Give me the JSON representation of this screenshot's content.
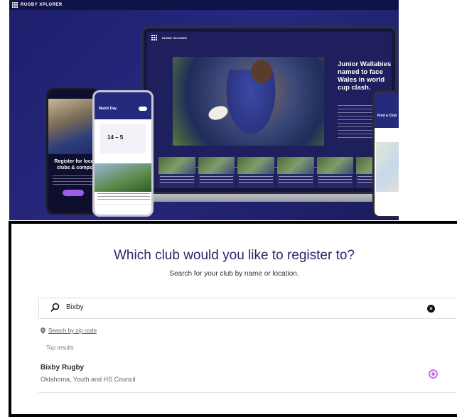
{
  "hero": {
    "brand": "RUGBY XPLORER",
    "laptop_brand": "RUGBY XPLORER",
    "headline": "Junior Wallabies named to face Wales in world cup clash.",
    "phone1_title": "Register for local clubs & comps",
    "phone2_header": "Match Day",
    "phone2_score": "14 – 5",
    "phone3_title": "Find a Club"
  },
  "register": {
    "title": "Which club would you like to register to?",
    "subtitle": "Search for your club by name or location.",
    "search_value": "Bixby",
    "zip_link": "Search by zip code",
    "results_label": "Top results",
    "results": [
      {
        "name": "Bixby Rugby",
        "description": "Oklahoma, Youth and HS Council",
        "selected": true
      }
    ]
  },
  "colors": {
    "accent": "#c471f0",
    "title": "#27286a",
    "hero_bg": "#28287e"
  }
}
